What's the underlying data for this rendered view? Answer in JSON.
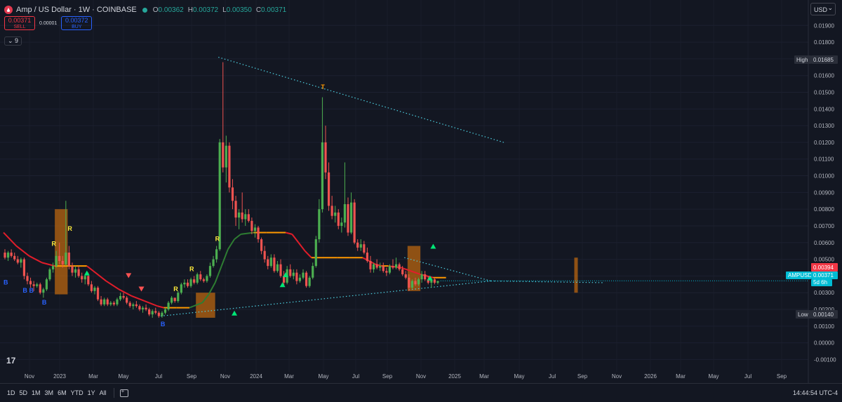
{
  "header": {
    "title": "Amp / US Dollar · 1W · COINBASE",
    "open_label": "O",
    "open": "0.00362",
    "high_label": "H",
    "high": "0.00372",
    "low_label": "L",
    "low": "0.00350",
    "close_label": "C",
    "close": "0.00371"
  },
  "trade": {
    "sell_price": "0.00371",
    "sell_label": "SELL",
    "spread": "0.00001",
    "buy_price": "0.00372",
    "buy_label": "BUY"
  },
  "indicators_toggle": "9",
  "currency": "USD",
  "bottom_bar": {
    "ranges": [
      "1D",
      "5D",
      "1M",
      "3M",
      "6M",
      "YTD",
      "1Y",
      "All"
    ],
    "clock": "14:44:54 UTC-4"
  },
  "colors": {
    "background": "#131722",
    "up": "#26a69a",
    "down": "#f23645",
    "candle_up": "#4caf50",
    "candle_down": "#ef5350",
    "trend": "#e11d2a",
    "trend_flat": "#ff9800",
    "trend_up": "#2e7d32",
    "box": "#c46b0e",
    "dotted": "#4dd0e1",
    "label_yellow": "#ffeb3b",
    "label_blue": "#2962ff"
  },
  "chart_data": {
    "type": "candlestick",
    "symbol": "AMPUSD",
    "timeframe": "1W",
    "x_tick_labels": [
      "Nov",
      "2023",
      "Mar",
      "May",
      "Jul",
      "Sep",
      "Nov",
      "2024",
      "Mar",
      "May",
      "Jul",
      "Sep",
      "Nov",
      "2025",
      "Mar",
      "May",
      "Jul",
      "Sep",
      "Nov",
      "2026",
      "Mar",
      "May",
      "Jul",
      "Sep"
    ],
    "y_tick_labels": [
      "0.01900",
      "0.01800",
      "0.01700",
      "0.01600",
      "0.01500",
      "0.01400",
      "0.01300",
      "0.01200",
      "0.01100",
      "0.01000",
      "0.00900",
      "0.00800",
      "0.00700",
      "0.00600",
      "0.00500",
      "0.00400",
      "0.00300",
      "0.00200",
      "0.00100",
      "0.00000",
      "-0.00100"
    ],
    "ylim": [
      -0.00115,
      0.0196
    ],
    "price_labels": {
      "high_label": "High",
      "high": "0.01685",
      "low_label": "Low",
      "low": "0.00140",
      "ma_value": "0.00394",
      "last_symbol": "AMPUSD",
      "last_price": "0.00371",
      "countdown": "5d 6h"
    },
    "signal_labels": [
      {
        "text": "B",
        "week": 0,
        "price": 0.0035
      },
      {
        "text": "B",
        "week": 6,
        "price": 0.003
      },
      {
        "text": "B",
        "week": 8,
        "price": 0.003
      },
      {
        "text": "B",
        "week": 12,
        "price": 0.0023
      },
      {
        "text": "R",
        "week": 15,
        "price": 0.0058
      },
      {
        "text": "R",
        "week": 20,
        "price": 0.0067
      },
      {
        "text": "B",
        "week": 49,
        "price": 0.001
      },
      {
        "text": "R",
        "week": 53,
        "price": 0.0031
      },
      {
        "text": "R",
        "week": 58,
        "price": 0.0043
      },
      {
        "text": "R",
        "week": 66,
        "price": 0.0061
      },
      {
        "text": "T",
        "week": 99,
        "price": 0.0152
      }
    ],
    "candles": [
      [
        0.0054,
        0.0056,
        0.005,
        0.0051
      ],
      [
        0.0051,
        0.0055,
        0.0049,
        0.0054
      ],
      [
        0.0054,
        0.0056,
        0.0051,
        0.0052
      ],
      [
        0.0052,
        0.0054,
        0.0049,
        0.005
      ],
      [
        0.005,
        0.0052,
        0.0047,
        0.0048
      ],
      [
        0.0048,
        0.0051,
        0.0045,
        0.005
      ],
      [
        0.005,
        0.0051,
        0.0038,
        0.004
      ],
      [
        0.004,
        0.0042,
        0.0035,
        0.0037
      ],
      [
        0.0037,
        0.0039,
        0.0033,
        0.0035
      ],
      [
        0.0035,
        0.0037,
        0.0031,
        0.0034
      ],
      [
        0.0034,
        0.0036,
        0.0033,
        0.0035
      ],
      [
        0.0035,
        0.0036,
        0.0029,
        0.003
      ],
      [
        0.003,
        0.0033,
        0.0027,
        0.0032
      ],
      [
        0.0032,
        0.0039,
        0.0031,
        0.0038
      ],
      [
        0.0038,
        0.0045,
        0.0037,
        0.0044
      ],
      [
        0.0044,
        0.0048,
        0.0042,
        0.0046
      ],
      [
        0.0046,
        0.0055,
        0.0045,
        0.0052
      ],
      [
        0.0052,
        0.006,
        0.0047,
        0.0049
      ],
      [
        0.0049,
        0.0052,
        0.0045,
        0.0047
      ],
      [
        0.0047,
        0.0085,
        0.0046,
        0.0054
      ],
      [
        0.0054,
        0.0058,
        0.0044,
        0.0046
      ],
      [
        0.0046,
        0.0048,
        0.004,
        0.0042
      ],
      [
        0.0042,
        0.0046,
        0.0039,
        0.0044
      ],
      [
        0.0044,
        0.0046,
        0.0039,
        0.004
      ],
      [
        0.004,
        0.0042,
        0.0036,
        0.0038
      ],
      [
        0.0038,
        0.0041,
        0.0035,
        0.004
      ],
      [
        0.004,
        0.0042,
        0.0034,
        0.0035
      ],
      [
        0.0035,
        0.0037,
        0.003,
        0.0031
      ],
      [
        0.0031,
        0.0034,
        0.0029,
        0.0033
      ],
      [
        0.0033,
        0.0034,
        0.0025,
        0.0026
      ],
      [
        0.0026,
        0.0028,
        0.0022,
        0.0023
      ],
      [
        0.0023,
        0.0027,
        0.0022,
        0.0026
      ],
      [
        0.0026,
        0.0027,
        0.0022,
        0.0023
      ],
      [
        0.0023,
        0.0025,
        0.0022,
        0.0024
      ],
      [
        0.0024,
        0.0025,
        0.0022,
        0.0023
      ],
      [
        0.0023,
        0.0027,
        0.0022,
        0.0026
      ],
      [
        0.0026,
        0.003,
        0.0025,
        0.0028
      ],
      [
        0.0028,
        0.003,
        0.0026,
        0.0027
      ],
      [
        0.0027,
        0.0028,
        0.0023,
        0.0024
      ],
      [
        0.0024,
        0.0025,
        0.0021,
        0.0022
      ],
      [
        0.0022,
        0.0024,
        0.002,
        0.0023
      ],
      [
        0.0023,
        0.0025,
        0.0021,
        0.0022
      ],
      [
        0.0022,
        0.0023,
        0.0019,
        0.002
      ],
      [
        0.002,
        0.0022,
        0.0018,
        0.0021
      ],
      [
        0.0021,
        0.0023,
        0.0019,
        0.002
      ],
      [
        0.002,
        0.0021,
        0.0016,
        0.0017
      ],
      [
        0.0017,
        0.002,
        0.0015,
        0.0019
      ],
      [
        0.0019,
        0.0021,
        0.0017,
        0.0018
      ],
      [
        0.0018,
        0.0019,
        0.0015,
        0.0016
      ],
      [
        0.0016,
        0.0019,
        0.0015,
        0.0018
      ],
      [
        0.0018,
        0.0021,
        0.0017,
        0.002
      ],
      [
        0.002,
        0.0025,
        0.0019,
        0.0024
      ],
      [
        0.0024,
        0.0028,
        0.0023,
        0.0027
      ],
      [
        0.0027,
        0.0026,
        0.0024,
        0.0025
      ],
      [
        0.0025,
        0.0031,
        0.0024,
        0.003
      ],
      [
        0.003,
        0.0036,
        0.0029,
        0.0035
      ],
      [
        0.0035,
        0.0038,
        0.0033,
        0.0036
      ],
      [
        0.0036,
        0.0038,
        0.0033,
        0.0034
      ],
      [
        0.0034,
        0.0039,
        0.0033,
        0.0038
      ],
      [
        0.0038,
        0.004,
        0.0035,
        0.0036
      ],
      [
        0.0036,
        0.0042,
        0.0035,
        0.0041
      ],
      [
        0.0041,
        0.0043,
        0.0037,
        0.0038
      ],
      [
        0.0038,
        0.0039,
        0.0036,
        0.0037
      ],
      [
        0.0037,
        0.0041,
        0.0036,
        0.004
      ],
      [
        0.004,
        0.0048,
        0.0039,
        0.0046
      ],
      [
        0.0046,
        0.0052,
        0.0045,
        0.005
      ],
      [
        0.005,
        0.0058,
        0.0048,
        0.0056
      ],
      [
        0.0056,
        0.0122,
        0.0055,
        0.012
      ],
      [
        0.012,
        0.0168,
        0.0102,
        0.0105
      ],
      [
        0.0105,
        0.0124,
        0.0096,
        0.0118
      ],
      [
        0.0118,
        0.012,
        0.009,
        0.0093
      ],
      [
        0.0093,
        0.0098,
        0.008,
        0.0085
      ],
      [
        0.0085,
        0.0088,
        0.007,
        0.0075
      ],
      [
        0.0075,
        0.008,
        0.0068,
        0.0078
      ],
      [
        0.0078,
        0.009,
        0.0072,
        0.0074
      ],
      [
        0.0074,
        0.008,
        0.007,
        0.0077
      ],
      [
        0.0077,
        0.008,
        0.0072,
        0.0073
      ],
      [
        0.0073,
        0.0075,
        0.0065,
        0.0067
      ],
      [
        0.0067,
        0.0071,
        0.0063,
        0.0069
      ],
      [
        0.0069,
        0.007,
        0.006,
        0.0062
      ],
      [
        0.0062,
        0.0063,
        0.0053,
        0.0055
      ],
      [
        0.0055,
        0.0058,
        0.0048,
        0.005
      ],
      [
        0.005,
        0.0052,
        0.0044,
        0.0046
      ],
      [
        0.0046,
        0.0053,
        0.0045,
        0.0051
      ],
      [
        0.0051,
        0.0053,
        0.0042,
        0.0043
      ],
      [
        0.0043,
        0.0049,
        0.0042,
        0.0047
      ],
      [
        0.0047,
        0.005,
        0.0039,
        0.004
      ],
      [
        0.004,
        0.0043,
        0.0034,
        0.0036
      ],
      [
        0.0036,
        0.0046,
        0.0035,
        0.0044
      ],
      [
        0.0044,
        0.0047,
        0.0039,
        0.004
      ],
      [
        0.004,
        0.0044,
        0.0038,
        0.0042
      ],
      [
        0.0042,
        0.0044,
        0.0035,
        0.0037
      ],
      [
        0.0037,
        0.0041,
        0.0036,
        0.0039
      ],
      [
        0.0039,
        0.0044,
        0.0038,
        0.0042
      ],
      [
        0.0042,
        0.0043,
        0.0033,
        0.0034
      ],
      [
        0.0034,
        0.004,
        0.0033,
        0.0039
      ],
      [
        0.0039,
        0.0048,
        0.0038,
        0.0046
      ],
      [
        0.0046,
        0.0064,
        0.0045,
        0.0062
      ],
      [
        0.0062,
        0.0086,
        0.006,
        0.008
      ],
      [
        0.008,
        0.0147,
        0.0078,
        0.012
      ],
      [
        0.012,
        0.013,
        0.0098,
        0.0102
      ],
      [
        0.0102,
        0.0108,
        0.0079,
        0.0082
      ],
      [
        0.0082,
        0.0088,
        0.0074,
        0.0076
      ],
      [
        0.0076,
        0.0082,
        0.0072,
        0.0078
      ],
      [
        0.0078,
        0.008,
        0.0068,
        0.007
      ],
      [
        0.007,
        0.0075,
        0.0066,
        0.0072
      ],
      [
        0.0072,
        0.0108,
        0.0069,
        0.0083
      ],
      [
        0.0083,
        0.0087,
        0.0064,
        0.0066
      ],
      [
        0.0066,
        0.009,
        0.0065,
        0.0084
      ],
      [
        0.0084,
        0.0086,
        0.0059,
        0.006
      ],
      [
        0.006,
        0.0062,
        0.0055,
        0.0057
      ],
      [
        0.0057,
        0.0062,
        0.0055,
        0.0059
      ],
      [
        0.0059,
        0.0061,
        0.0053,
        0.0054
      ],
      [
        0.0054,
        0.0057,
        0.0048,
        0.0049
      ],
      [
        0.0049,
        0.0052,
        0.0042,
        0.0044
      ],
      [
        0.0044,
        0.0048,
        0.0042,
        0.0047
      ],
      [
        0.0047,
        0.005,
        0.0044,
        0.0045
      ],
      [
        0.0045,
        0.0048,
        0.0043,
        0.0046
      ],
      [
        0.0046,
        0.0048,
        0.0042,
        0.0043
      ],
      [
        0.0043,
        0.0045,
        0.004,
        0.0042
      ],
      [
        0.0042,
        0.0047,
        0.0041,
        0.0046
      ],
      [
        0.0046,
        0.005,
        0.0044,
        0.0045
      ],
      [
        0.0045,
        0.0051,
        0.0044,
        0.0047
      ],
      [
        0.0047,
        0.0048,
        0.0043,
        0.0044
      ],
      [
        0.0044,
        0.0046,
        0.004,
        0.0041
      ],
      [
        0.0041,
        0.0043,
        0.0038,
        0.0039
      ],
      [
        0.0039,
        0.0041,
        0.0031,
        0.0033
      ],
      [
        0.0033,
        0.0038,
        0.0032,
        0.0037
      ],
      [
        0.0037,
        0.0039,
        0.0034,
        0.0035
      ],
      [
        0.0035,
        0.0039,
        0.0034,
        0.0038
      ],
      [
        0.0038,
        0.0043,
        0.0036,
        0.0041
      ],
      [
        0.0041,
        0.0043,
        0.0037,
        0.0038
      ],
      [
        0.0038,
        0.004,
        0.0035,
        0.0036
      ],
      [
        0.0036,
        0.0039,
        0.0033,
        0.0038
      ],
      [
        0.0038,
        0.0039,
        0.0035,
        0.0036
      ],
      [
        0.0036,
        0.0037,
        0.0035,
        0.0037
      ]
    ],
    "moving_average": [
      [
        0,
        0.0066
      ],
      [
        4,
        0.0058
      ],
      [
        8,
        0.0052
      ],
      [
        12,
        0.0048
      ],
      [
        16,
        0.0046
      ],
      [
        20,
        0.0046
      ],
      [
        26,
        0.0046
      ],
      [
        28,
        0.0043
      ],
      [
        32,
        0.0037
      ],
      [
        36,
        0.0032
      ],
      [
        40,
        0.0028
      ],
      [
        44,
        0.0025
      ],
      [
        48,
        0.0022
      ],
      [
        50,
        0.0021
      ],
      [
        54,
        0.0021
      ],
      [
        58,
        0.0021
      ],
      [
        62,
        0.0024
      ],
      [
        64,
        0.0029
      ],
      [
        66,
        0.0036
      ],
      [
        68,
        0.0046
      ],
      [
        70,
        0.0056
      ],
      [
        72,
        0.0062
      ],
      [
        74,
        0.0065
      ],
      [
        78,
        0.0066
      ],
      [
        82,
        0.0066
      ],
      [
        86,
        0.0066
      ],
      [
        88,
        0.0066
      ],
      [
        90,
        0.0065
      ],
      [
        92,
        0.006
      ],
      [
        94,
        0.0055
      ],
      [
        96,
        0.0051
      ],
      [
        100,
        0.0051
      ],
      [
        104,
        0.0051
      ],
      [
        108,
        0.0051
      ],
      [
        112,
        0.0051
      ],
      [
        114,
        0.0049
      ],
      [
        116,
        0.0047
      ],
      [
        118,
        0.0046
      ],
      [
        120,
        0.0046
      ],
      [
        124,
        0.0045
      ],
      [
        127,
        0.0043
      ],
      [
        130,
        0.0041
      ],
      [
        134,
        0.0039
      ],
      [
        138,
        0.0039
      ]
    ],
    "trend_line_top": [
      [
        67,
        0.0171
      ],
      [
        156,
        0.012
      ]
    ],
    "trend_line_bottom": [
      [
        49,
        0.0016
      ],
      [
        152,
        0.0037
      ]
    ],
    "trend_line_wedge": [
      [
        125,
        0.0051
      ],
      [
        152,
        0.0037
      ]
    ]
  }
}
